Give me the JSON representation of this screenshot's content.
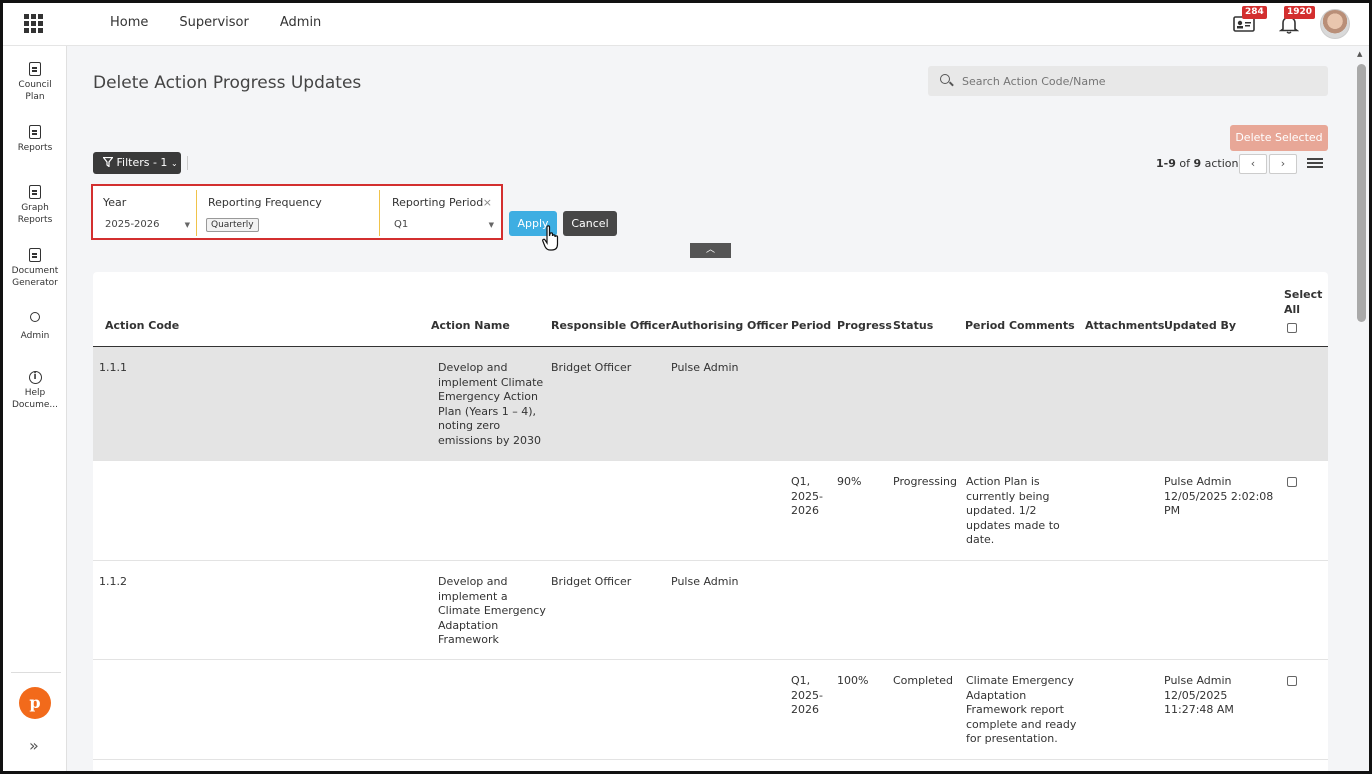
{
  "nav": {
    "items": [
      "Home",
      "Supervisor",
      "Admin"
    ]
  },
  "top": {
    "contacts_badge": "284",
    "bell_badge": "1920"
  },
  "sidebar": {
    "items": [
      {
        "label": "Council Plan",
        "icon": "clipboard-icon"
      },
      {
        "label": "Reports",
        "icon": "document-icon"
      },
      {
        "label": "Graph Reports",
        "icon": "chart-document-icon"
      },
      {
        "label": "Document Generator",
        "icon": "word-document-icon"
      },
      {
        "label": "Admin",
        "icon": "user-shield-icon"
      },
      {
        "label": "Help Docume...",
        "icon": "info-icon"
      }
    ],
    "logo": "p",
    "expand": "»"
  },
  "page": {
    "title": "Delete Action Progress Updates"
  },
  "search": {
    "placeholder": "Search Action Code/Name"
  },
  "toolbar": {
    "delete_label": "Delete Selected",
    "filters_label": "Filters - 1",
    "pager_range": "1-9",
    "pager_of": "of",
    "pager_total": "9",
    "pager_unit": "actions"
  },
  "filters": {
    "year": {
      "label": "Year",
      "value": "2025-2026"
    },
    "frequency": {
      "label": "Reporting Frequency",
      "value": "Quarterly"
    },
    "period": {
      "label": "Reporting Period",
      "value": "Q1"
    },
    "apply_label": "Apply",
    "cancel_label": "Cancel"
  },
  "table": {
    "headers": {
      "action_code": "Action Code",
      "action_name": "Action Name",
      "responsible": "Responsible Officer",
      "authorising": "Authorising Officer",
      "period": "Period",
      "progress": "Progress",
      "status": "Status",
      "comments": "Period Comments",
      "attachments": "Attachments",
      "updated_by": "Updated By",
      "select_all": "Select All"
    },
    "rows": [
      {
        "code": "1.1.1",
        "name": "Develop and implement Climate Emergency Action Plan (Years 1 – 4), noting zero emissions by 2030",
        "responsible": "Bridget Officer",
        "authorising": "Pulse Admin",
        "period": "Q1, 2025-2026",
        "progress": "90%",
        "status": "Progressing",
        "comments": "Action Plan is currently being updated. 1/2 updates made to date.",
        "updated_by": "Pulse Admin 12/05/2025 2:02:08 PM"
      },
      {
        "code": "1.1.2",
        "name": "Develop and implement a Climate Emergency Adaptation Framework",
        "responsible": "Bridget Officer",
        "authorising": "Pulse Admin",
        "period": "Q1, 2025-2026",
        "progress": "100%",
        "status": "Completed",
        "comments": "Climate Emergency Adaptation Framework report complete and ready for presentation.",
        "updated_by": "Pulse Admin 12/05/2025 11:27:48 AM"
      }
    ]
  }
}
